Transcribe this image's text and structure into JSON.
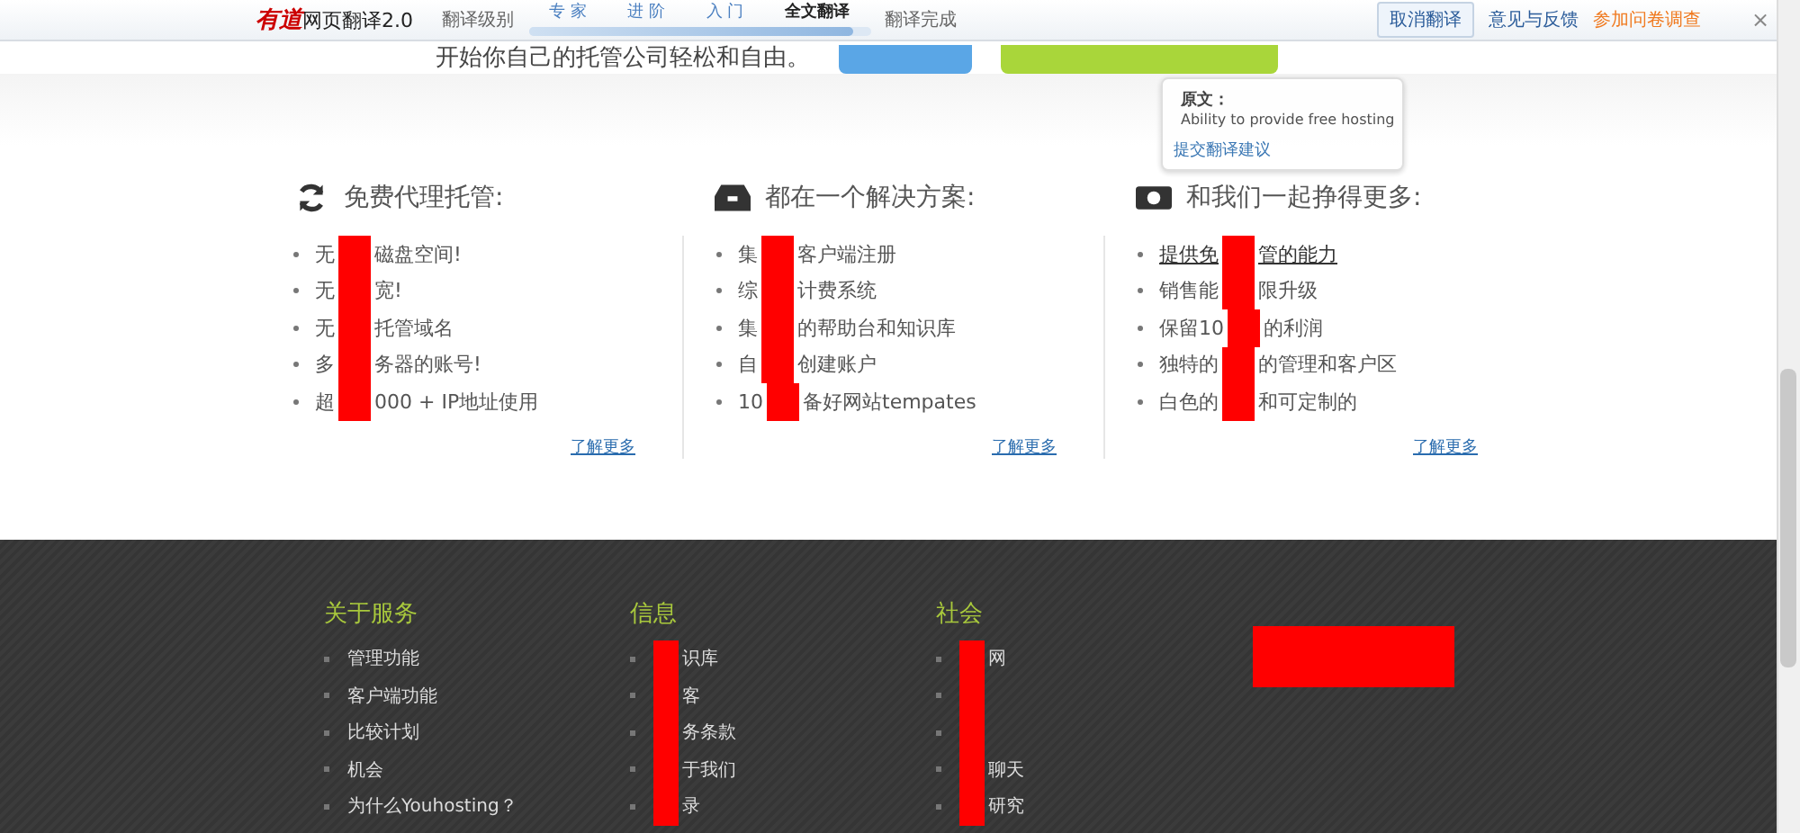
{
  "translate_bar": {
    "logo_mark": "有道",
    "logo_text": "网页翻译2.0",
    "level_label": "翻译级别",
    "levels": [
      {
        "label": "专 家",
        "selected": false
      },
      {
        "label": "进 阶",
        "selected": false
      },
      {
        "label": "入 门",
        "selected": false
      },
      {
        "label": "全文翻译",
        "selected": true
      }
    ],
    "progress": {
      "level": 0.95
    },
    "status": "翻译完成",
    "cancel_button": "取消翻译",
    "links": [
      {
        "label": "意见与反馈",
        "kind": "feedback"
      },
      {
        "label": "参加问卷调查",
        "kind": "survey"
      }
    ],
    "close": "×"
  },
  "hero": {
    "text": "开始你自己的托管公司轻松和自由。"
  },
  "features": [
    {
      "title": "免费代理托管:",
      "items": [
        {
          "before": "无",
          "after": "磁盘空间!",
          "redacted": true,
          "hovered": false
        },
        {
          "before": "无",
          "after": "宽!",
          "redacted": true,
          "hovered": false
        },
        {
          "before": "无",
          "after": "托管域名",
          "redacted": true,
          "hovered": false
        },
        {
          "before": "多",
          "after": "务器的账号!",
          "redacted": true,
          "hovered": false
        },
        {
          "before": "超",
          "after": "000 + IP地址使用",
          "redacted": true,
          "hovered": false
        }
      ],
      "more": "了解更多"
    },
    {
      "title": "都在一个解决方案:",
      "items": [
        {
          "before": "集",
          "after": "客户端注册",
          "redacted": true,
          "hovered": false
        },
        {
          "before": "综",
          "after": "计费系统",
          "redacted": true,
          "hovered": false
        },
        {
          "before": "集",
          "after": "的帮助台和知识库",
          "redacted": true,
          "hovered": false
        },
        {
          "before": "自",
          "after": "创建账户",
          "redacted": true,
          "hovered": false
        },
        {
          "before": "10",
          "after": "备好网站tempates",
          "redacted": true,
          "hovered": false
        }
      ],
      "more": "了解更多"
    },
    {
      "title": "和我们一起挣得更多:",
      "items": [
        {
          "before": "提供免",
          "after": "管的能力",
          "redacted": true,
          "hovered": true
        },
        {
          "before": "销售能",
          "after": "限升级",
          "redacted": true,
          "hovered": false
        },
        {
          "before": "保留10",
          "after": "的利润",
          "redacted": true,
          "hovered": false
        },
        {
          "before": "独特的",
          "after": "的管理和客户区",
          "redacted": true,
          "hovered": false
        },
        {
          "before": "白色的",
          "after": "和可定制的",
          "redacted": true,
          "hovered": false
        }
      ],
      "more": "了解更多"
    }
  ],
  "tooltip": {
    "heading": "原文：",
    "original": "Ability to provide free hosting",
    "suggest_link": "提交翻译建议"
  },
  "footer": {
    "columns": [
      {
        "title": "关于服务",
        "items": [
          {
            "after": "管理功能",
            "redacted": false
          },
          {
            "after": "客户端功能",
            "redacted": false
          },
          {
            "after": "比较计划",
            "redacted": false
          },
          {
            "after": "机会",
            "redacted": false
          },
          {
            "after": "为什么Youhosting？",
            "redacted": false
          }
        ]
      },
      {
        "title": "信息",
        "items": [
          {
            "after": "识库",
            "redacted": true
          },
          {
            "after": "客",
            "redacted": true
          },
          {
            "after": "务条款",
            "redacted": true
          },
          {
            "after": "于我们",
            "redacted": true
          },
          {
            "after": "录",
            "redacted": true
          }
        ]
      },
      {
        "title": "社会",
        "items": [
          {
            "after": "网",
            "redacted": true
          },
          {
            "redacted": true
          },
          {
            "redacted": true
          },
          {
            "after": "聊天",
            "redacted": true
          },
          {
            "after": "研究",
            "redacted": true
          }
        ]
      }
    ]
  }
}
